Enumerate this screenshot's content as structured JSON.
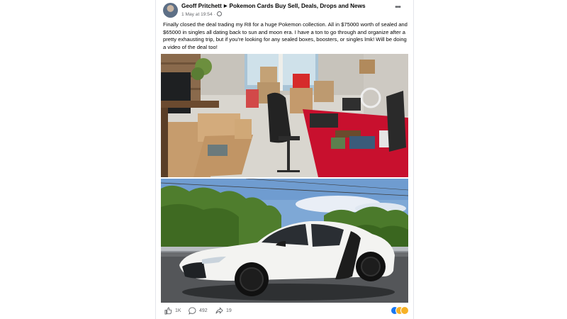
{
  "post": {
    "author": "Geoff Pritchett",
    "group": "Pokemon Cards Buy Sell, Deals, Drops and News",
    "timestamp": "1 May at 19:54 ·",
    "body": "Finally closed the deal trading my R8 for a huge Pokemon collection.  All in $75000 worth of sealed and $65000 in singles all dating back to sun and moon era.  I have a ton to go through and organize after a pretty exhausting trip, but if you're looking for any sealed boxes, boosters, or singles lmk! Will be doing a video of the deal too!"
  },
  "actions": {
    "like_count": "1K",
    "comment_count": "492",
    "share_count": "19"
  },
  "icons": {
    "more": "more-options-icon",
    "privacy": "globe-icon",
    "like": "thumbs-up-icon",
    "comment": "comment-bubble-icon",
    "share": "share-arrow-icon"
  },
  "colors": {
    "link_text": "#050505",
    "muted_text": "#65676b",
    "like_blue": "#1877f2",
    "table_red": "#c8102e"
  }
}
